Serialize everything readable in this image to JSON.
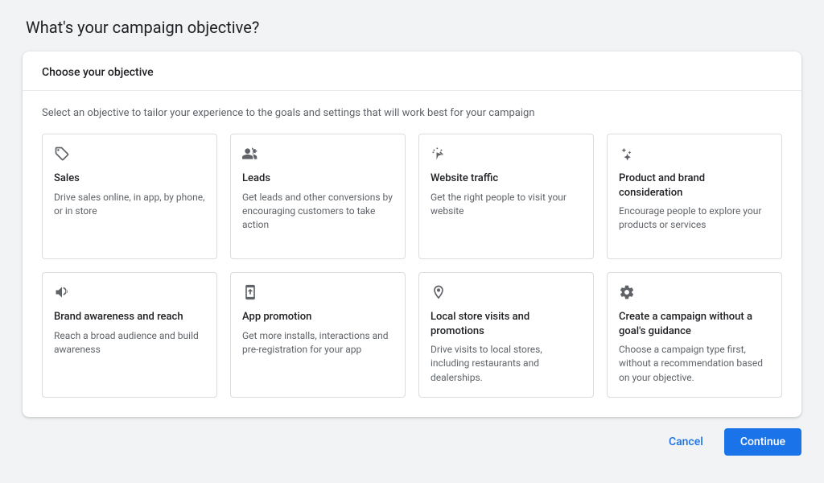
{
  "page_title": "What's your campaign objective?",
  "card_header": "Choose your objective",
  "instruction": "Select an objective to tailor your experience to the goals and settings that will work best for your campaign",
  "objectives": [
    {
      "icon": "tag",
      "title": "Sales",
      "desc": "Drive sales online, in app, by phone, or in store"
    },
    {
      "icon": "people",
      "title": "Leads",
      "desc": "Get leads and other conversions by encouraging customers to take action"
    },
    {
      "icon": "click",
      "title": "Website traffic",
      "desc": "Get the right people to visit your website"
    },
    {
      "icon": "sparkle",
      "title": "Product and brand consideration",
      "desc": "Encourage people to explore your products or services"
    },
    {
      "icon": "megaphone",
      "title": "Brand awareness and reach",
      "desc": "Reach a broad audience and build awareness"
    },
    {
      "icon": "phone",
      "title": "App promotion",
      "desc": "Get more installs, interactions and pre-registration for your app"
    },
    {
      "icon": "pin",
      "title": "Local store visits and promotions",
      "desc": "Drive visits to local stores, including restaurants and dealerships."
    },
    {
      "icon": "gear",
      "title": "Create a campaign without a goal's guidance",
      "desc": "Choose a campaign type first, without a recommendation based on your objective."
    }
  ],
  "buttons": {
    "cancel": "Cancel",
    "continue": "Continue"
  }
}
